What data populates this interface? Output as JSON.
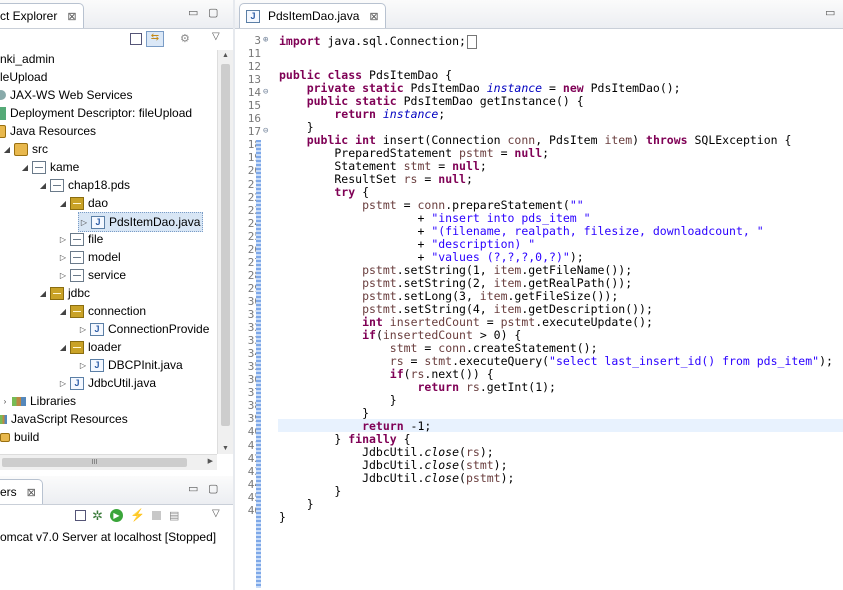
{
  "explorer": {
    "tab_title": "ct Explorer",
    "tree": [
      {
        "label": "nki_admin"
      },
      {
        "label": "leUpload"
      },
      {
        "label": "JAX-WS Web Services"
      },
      {
        "label": "Deployment Descriptor: fileUpload"
      },
      {
        "label": "Java Resources"
      },
      {
        "label": "src"
      },
      {
        "label": "kame"
      },
      {
        "label": "chap18.pds"
      },
      {
        "label": "dao"
      },
      {
        "label": "PdsItemDao.java"
      },
      {
        "label": "file"
      },
      {
        "label": "model"
      },
      {
        "label": "service"
      },
      {
        "label": "jdbc"
      },
      {
        "label": "connection"
      },
      {
        "label": "ConnectionProvide"
      },
      {
        "label": "loader"
      },
      {
        "label": "DBCPInit.java"
      },
      {
        "label": "JdbcUtil.java"
      },
      {
        "label": "Libraries"
      },
      {
        "label": "JavaScript Resources"
      },
      {
        "label": "build"
      }
    ],
    "hscroll_glyph": "III"
  },
  "servers": {
    "tab_title": "ers",
    "item": "omcat v7.0 Server at localhost  [Stopped]"
  },
  "editor": {
    "tab_title": "PdsItemDao.java",
    "lines": [
      {
        "n": "3",
        "fold": "⊕"
      },
      {
        "n": "11"
      },
      {
        "n": "12"
      },
      {
        "n": "13"
      },
      {
        "n": "14",
        "fold": "⊖"
      },
      {
        "n": "15"
      },
      {
        "n": "16"
      },
      {
        "n": "17",
        "fold": "⊖"
      },
      {
        "n": "18"
      },
      {
        "n": "19"
      },
      {
        "n": "20"
      },
      {
        "n": "21"
      },
      {
        "n": "22"
      },
      {
        "n": "23"
      },
      {
        "n": "24"
      },
      {
        "n": "25"
      },
      {
        "n": "26"
      },
      {
        "n": "27"
      },
      {
        "n": "28"
      },
      {
        "n": "29"
      },
      {
        "n": "30"
      },
      {
        "n": "31"
      },
      {
        "n": "32"
      },
      {
        "n": "33"
      },
      {
        "n": "34"
      },
      {
        "n": "35"
      },
      {
        "n": "36"
      },
      {
        "n": "37"
      },
      {
        "n": "38"
      },
      {
        "n": "39"
      },
      {
        "n": "40"
      },
      {
        "n": "41"
      },
      {
        "n": "42"
      },
      {
        "n": "43"
      },
      {
        "n": "44"
      },
      {
        "n": "45"
      },
      {
        "n": "46"
      }
    ],
    "code": {
      "l3a": "import",
      "l3b": " java.sql.Connection;",
      "l12a": "public class",
      "l12b": " PdsItemDao {",
      "l13a": "    private static",
      "l13b": " PdsItemDao ",
      "l13c": "instance",
      "l13d": " = ",
      "l13e": "new",
      "l13f": " PdsItemDao();",
      "l14a": "    public static",
      "l14b": " PdsItemDao getInstance() {",
      "l15a": "        return",
      "l15b": " ",
      "l15c": "instance",
      "l15d": ";",
      "l16": "    }",
      "l17a": "    public int",
      "l17b": " insert(Connection ",
      "l17c": "conn",
      "l17d": ", PdsItem ",
      "l17e": "item",
      "l17f": ") ",
      "l17g": "throws",
      "l17h": " SQLException {",
      "l18a": "        PreparedStatement ",
      "l18b": "pstmt",
      "l18c": " = ",
      "l18d": "null",
      "l18e": ";",
      "l19a": "        Statement ",
      "l19b": "stmt",
      "l19c": " = ",
      "l19d": "null",
      "l19e": ";",
      "l20a": "        ResultSet ",
      "l20b": "rs",
      "l20c": " = ",
      "l20d": "null",
      "l20e": ";",
      "l21a": "        try",
      "l21b": " {",
      "l22a": "            pstmt",
      "l22b": " = ",
      "l22c": "conn",
      "l22d": ".prepareStatement(",
      "l22e": "\"\"",
      "l23a": "                    + ",
      "l23b": "\"insert into pds_item \"",
      "l24a": "                    + ",
      "l24b": "\"(filename, realpath, filesize, downloadcount, \"",
      "l25a": "                    + ",
      "l25b": "\"description) \"",
      "l26a": "                    + ",
      "l26b": "\"values (?,?,?,0,?)\"",
      "l26c": ");",
      "l27a": "            pstmt",
      "l27b": ".setString(1, ",
      "l27c": "item",
      "l27d": ".getFileName());",
      "l28a": "            pstmt",
      "l28b": ".setString(2, ",
      "l28c": "item",
      "l28d": ".getRealPath());",
      "l29a": "            pstmt",
      "l29b": ".setLong(3, ",
      "l29c": "item",
      "l29d": ".getFileSize());",
      "l30a": "            pstmt",
      "l30b": ".setString(4, ",
      "l30c": "item",
      "l30d": ".getDescription());",
      "l31a": "            int",
      "l31b": " ",
      "l31c": "insertedCount",
      "l31d": " = ",
      "l31e": "pstmt",
      "l31f": ".executeUpdate();",
      "l32a": "            if",
      "l32b": "(",
      "l32c": "insertedCount",
      "l32d": " > 0) {",
      "l33a": "                stmt",
      "l33b": " = ",
      "l33c": "conn",
      "l33d": ".createStatement();",
      "l34a": "                rs",
      "l34b": " = ",
      "l34c": "stmt",
      "l34d": ".executeQuery(",
      "l34e": "\"select last_insert_id() from pds_item\"",
      "l34f": ");",
      "l35a": "                if",
      "l35b": "(",
      "l35c": "rs",
      "l35d": ".next()) {",
      "l36a": "                    return",
      "l36b": " ",
      "l36c": "rs",
      "l36d": ".getInt(1);",
      "l37": "                }",
      "l38": "            }",
      "l39a": "            return",
      "l39b": " -1;",
      "l40a": "        } ",
      "l40b": "finally",
      "l40c": " {",
      "l41a": "            JdbcUtil.",
      "l41b": "close",
      "l41c": "(",
      "l41d": "rs",
      "l41e": ");",
      "l42a": "            JdbcUtil.",
      "l42b": "close",
      "l42c": "(",
      "l42d": "stmt",
      "l42e": ");",
      "l43a": "            JdbcUtil.",
      "l43b": "close",
      "l43c": "(",
      "l43d": "pstmt",
      "l43e": ");",
      "l44": "        }",
      "l45": "    }",
      "l46": "}"
    }
  }
}
